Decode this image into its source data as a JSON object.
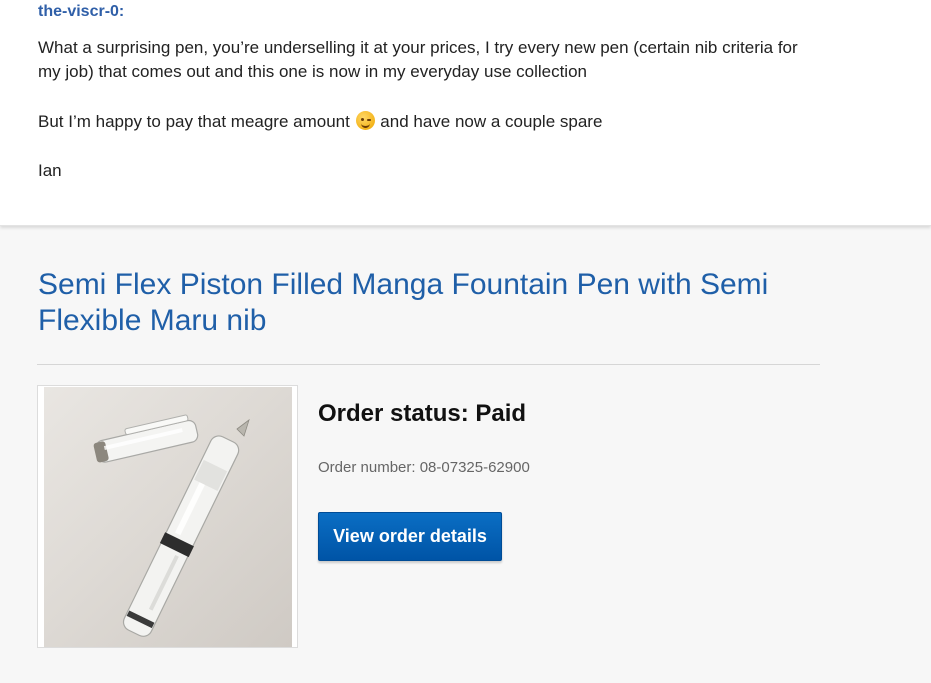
{
  "message": {
    "sender": "the-viscr-0:",
    "paragraph1": "What a surprising pen, you’re underselling it at your prices, I try every new pen (certain nib criteria for my job) that comes out and this one is now in my everyday use collection",
    "paragraph2_before": "But I’m happy to pay that meagre amount ",
    "paragraph2_emoji": "winking-face-emoji",
    "paragraph2_after": " and have now a couple spare",
    "signature": "Ian"
  },
  "product": {
    "title": "Semi Flex Piston Filled Manga Fountain Pen with Semi Flexible Maru nib",
    "image_icon": "fountain-pen-photo"
  },
  "order": {
    "status": "Order status: Paid",
    "number": "Order number: 08-07325-62900",
    "view_details_label": "View order details"
  },
  "colors": {
    "sender": "#2f5fa8",
    "product_title": "#1f5fa8",
    "button": "#0054a6",
    "page_background": "#f7f7f7"
  }
}
